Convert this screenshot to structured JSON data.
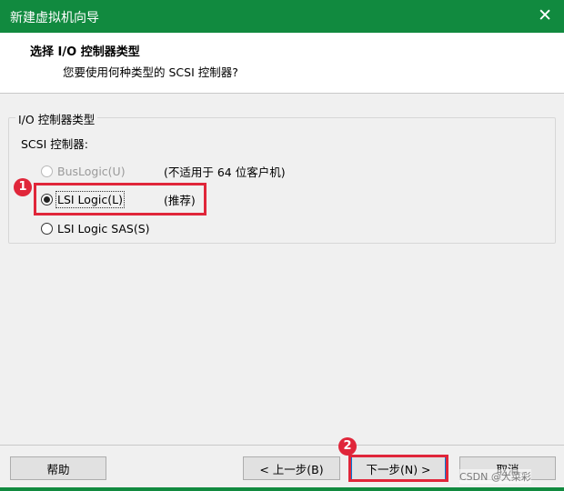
{
  "window": {
    "title": "新建虚拟机向导",
    "close_glyph": "✕"
  },
  "header": {
    "title": "选择 I/O 控制器类型",
    "subtitle": "您要使用何种类型的 SCSI 控制器?"
  },
  "group": {
    "legend": "I/O 控制器类型",
    "controller_label": "SCSI 控制器:",
    "options": [
      {
        "label": "BusLogic(U)",
        "note": "(不适用于 64 位客户机)",
        "selected": false,
        "disabled": true
      },
      {
        "label": "LSI Logic(L)",
        "note": "(推荐)",
        "selected": true,
        "disabled": false
      },
      {
        "label": "LSI Logic SAS(S)",
        "note": "",
        "selected": false,
        "disabled": false
      }
    ]
  },
  "annotations": {
    "badge1": "1",
    "badge2": "2",
    "color": "#e0263a"
  },
  "buttons": {
    "help": "帮助",
    "back": "< 上一步(B)",
    "next": "下一步(N) >",
    "cancel": "取消"
  },
  "watermark": "CSDN @大菜彩",
  "colors": {
    "titlebar": "#118a3f",
    "background": "#f0f0f0",
    "highlight": "#e0263a"
  }
}
